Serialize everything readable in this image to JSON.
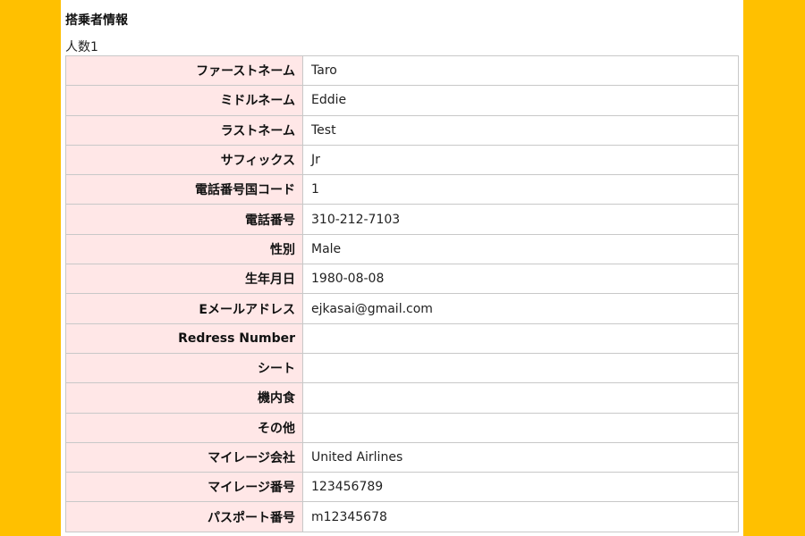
{
  "section": {
    "title": "搭乗者情報",
    "count_label": "人数1"
  },
  "passenger": {
    "rows": [
      {
        "label": "ファーストネーム",
        "value": "Taro"
      },
      {
        "label": "ミドルネーム",
        "value": "Eddie"
      },
      {
        "label": "ラストネーム",
        "value": "Test"
      },
      {
        "label": "サフィックス",
        "value": "Jr"
      },
      {
        "label": "電話番号国コード",
        "value": "1"
      },
      {
        "label": "電話番号",
        "value": "310-212-7103"
      },
      {
        "label": "性別",
        "value": "Male"
      },
      {
        "label": "生年月日",
        "value": "1980-08-08"
      },
      {
        "label": "Eメールアドレス",
        "value": "ejkasai@gmail.com"
      },
      {
        "label": "Redress Number",
        "value": ""
      },
      {
        "label": "シート",
        "value": ""
      },
      {
        "label": "機内食",
        "value": ""
      },
      {
        "label": "その他",
        "value": ""
      },
      {
        "label": "マイレージ会社",
        "value": "United Airlines"
      },
      {
        "label": "マイレージ番号",
        "value": "123456789"
      },
      {
        "label": "パスポート番号",
        "value": "m12345678"
      }
    ]
  }
}
